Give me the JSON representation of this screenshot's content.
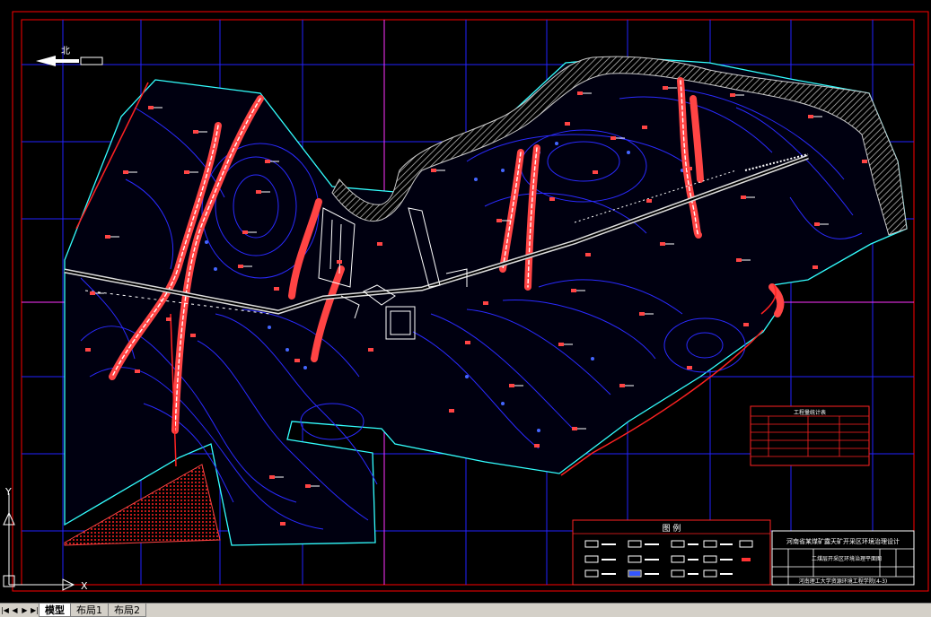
{
  "north_arrow": {
    "label": "北"
  },
  "legend": {
    "title": "图 例"
  },
  "title_block": {
    "project": "河南省某煤矿露天矿开采区环境治理设计",
    "drawing_name": "二煤层开采区环境治理平面图",
    "company": "河南理工大学资源环境工程学院(4-3)"
  },
  "info_table": {
    "heading": "工程量统计表"
  },
  "ucs": {
    "y_label": "Y",
    "x_label": "X"
  },
  "tabs": [
    {
      "label": "模型",
      "active": true
    },
    {
      "label": "布局1",
      "active": false
    },
    {
      "label": "布局2",
      "active": false
    }
  ],
  "colors": {
    "background": "#000000",
    "frame": "#ff0000",
    "grid": "#0000ff",
    "axis": "#ff00ff",
    "contour": "#1a1aff",
    "boundary": "#00ffff",
    "gully": "#ff3333"
  }
}
